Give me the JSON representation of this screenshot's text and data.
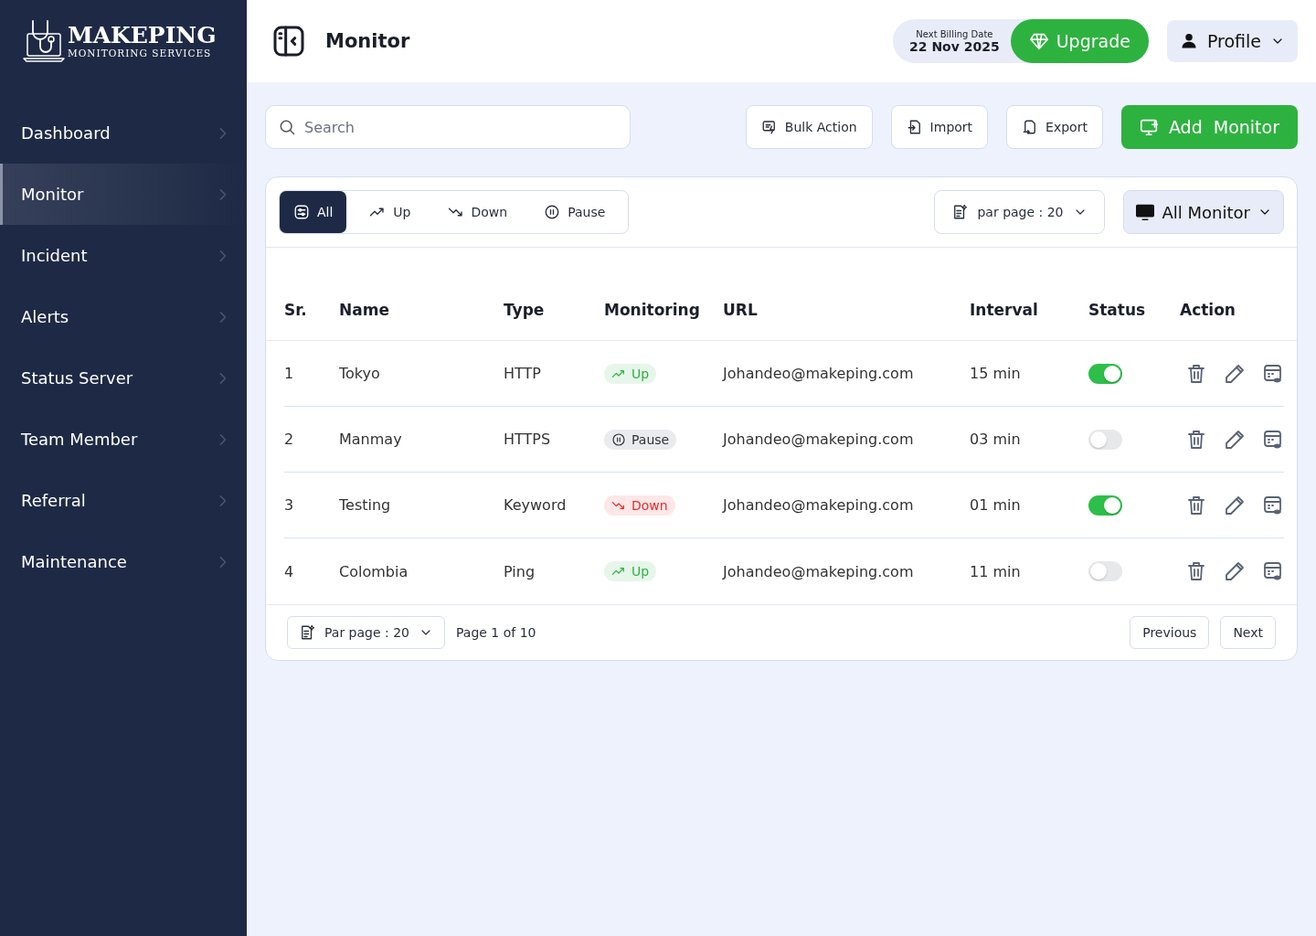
{
  "brand": {
    "name": "MAKEPING",
    "tagline": "MONITORING SERVICES"
  },
  "sidebar": {
    "items": [
      {
        "label": "Dashboard",
        "selected": false
      },
      {
        "label": "Monitor",
        "selected": true
      },
      {
        "label": "Incident",
        "selected": false
      },
      {
        "label": "Alerts",
        "selected": false
      },
      {
        "label": "Status Server",
        "selected": false
      },
      {
        "label": "Team Member",
        "selected": false
      },
      {
        "label": "Referral",
        "selected": false
      },
      {
        "label": "Maintenance",
        "selected": false
      }
    ]
  },
  "header": {
    "title": "Monitor",
    "billing_label": "Next Billing Date",
    "billing_date": "22 Nov 2025",
    "upgrade": "Upgrade",
    "profile": "Profile"
  },
  "toolbar": {
    "search_placeholder": "Search",
    "buttons": [
      {
        "label": "Bulk Action",
        "kind": "bulk"
      },
      {
        "label": "Import",
        "kind": "import"
      },
      {
        "label": "Export",
        "kind": "export"
      }
    ],
    "add": "Add  Monitor"
  },
  "filters": [
    {
      "label": "All",
      "kind": "all",
      "selected": true
    },
    {
      "label": "Up",
      "kind": "up",
      "selected": false
    },
    {
      "label": "Down",
      "kind": "down",
      "selected": false
    },
    {
      "label": "Pause",
      "kind": "pause",
      "selected": false
    }
  ],
  "per_page_top": "par page : 20",
  "monitor_select": "All Monitor",
  "table": {
    "columns": [
      "Sr.",
      "Name",
      "Type",
      "Monitoring",
      "URL",
      "Interval",
      "Status",
      "Action"
    ],
    "rows": [
      {
        "sr": "1",
        "name": "Tokyo",
        "type": "HTTP",
        "monitoring": {
          "label": "Up",
          "kind": "up"
        },
        "url": "Johandeo@makeping.com",
        "interval": "15 min",
        "on": true
      },
      {
        "sr": "2",
        "name": "Manmay",
        "type": "HTTPS",
        "monitoring": {
          "label": "Pause",
          "kind": "pause"
        },
        "url": "Johandeo@makeping.com",
        "interval": "03 min",
        "on": false
      },
      {
        "sr": "3",
        "name": "Testing",
        "type": "Keyword",
        "monitoring": {
          "label": "Down",
          "kind": "down"
        },
        "url": "Johandeo@makeping.com",
        "interval": "01 min",
        "on": true
      },
      {
        "sr": "4",
        "name": "Colombia",
        "type": "Ping",
        "monitoring": {
          "label": "Up",
          "kind": "up"
        },
        "url": "Johandeo@makeping.com",
        "interval": "11 min",
        "on": false
      }
    ]
  },
  "pagination": {
    "per_page": "Par page : 20",
    "page": "Page 1 of 10",
    "previous": "Previous",
    "next": "Next"
  }
}
